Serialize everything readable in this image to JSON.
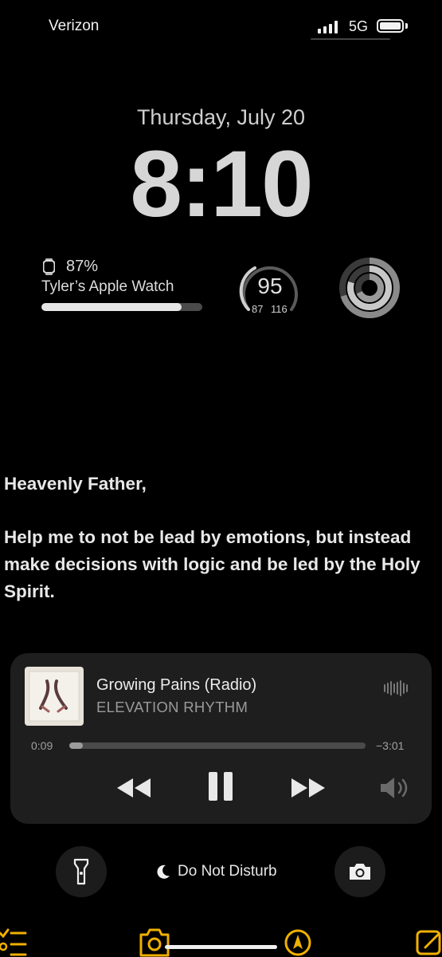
{
  "status_bar": {
    "carrier": "Verizon",
    "network": "5G",
    "signal_bars": 4,
    "battery_level": 1.0
  },
  "lock_screen": {
    "date": "Thursday, July 20",
    "time": "8:10"
  },
  "widgets": {
    "watch": {
      "icon": "apple-watch-icon",
      "battery_percent_label": "87%",
      "battery_fraction": 0.87,
      "device_name": "Tyler’s Apple Watch"
    },
    "gauge": {
      "value": "95",
      "low": "87",
      "high": "116"
    },
    "activity_rings": {
      "icon": "activity-rings-icon"
    }
  },
  "prayer": {
    "greeting": "Heavenly Father,",
    "body": "Help me to not be lead by emotions, but instead make decisions with logic and be led by the Holy Spirit."
  },
  "now_playing": {
    "title": "Growing Pains (Radio)",
    "artist": "ELEVATION RHYTHM",
    "elapsed": "0:09",
    "remaining": "−3:01",
    "progress_fraction": 0.047,
    "controls": [
      "rewind-icon",
      "pause-icon",
      "fast-forward-icon",
      "volume-icon"
    ]
  },
  "quick_actions": {
    "flashlight_icon": "flashlight-icon",
    "focus_icon": "moon-icon",
    "focus_label": "Do Not Disturb",
    "camera_icon": "camera-icon"
  },
  "colors": {
    "background": "#000000",
    "player_bg": "#1e1e1e",
    "dock_accent": "#f0b000"
  }
}
